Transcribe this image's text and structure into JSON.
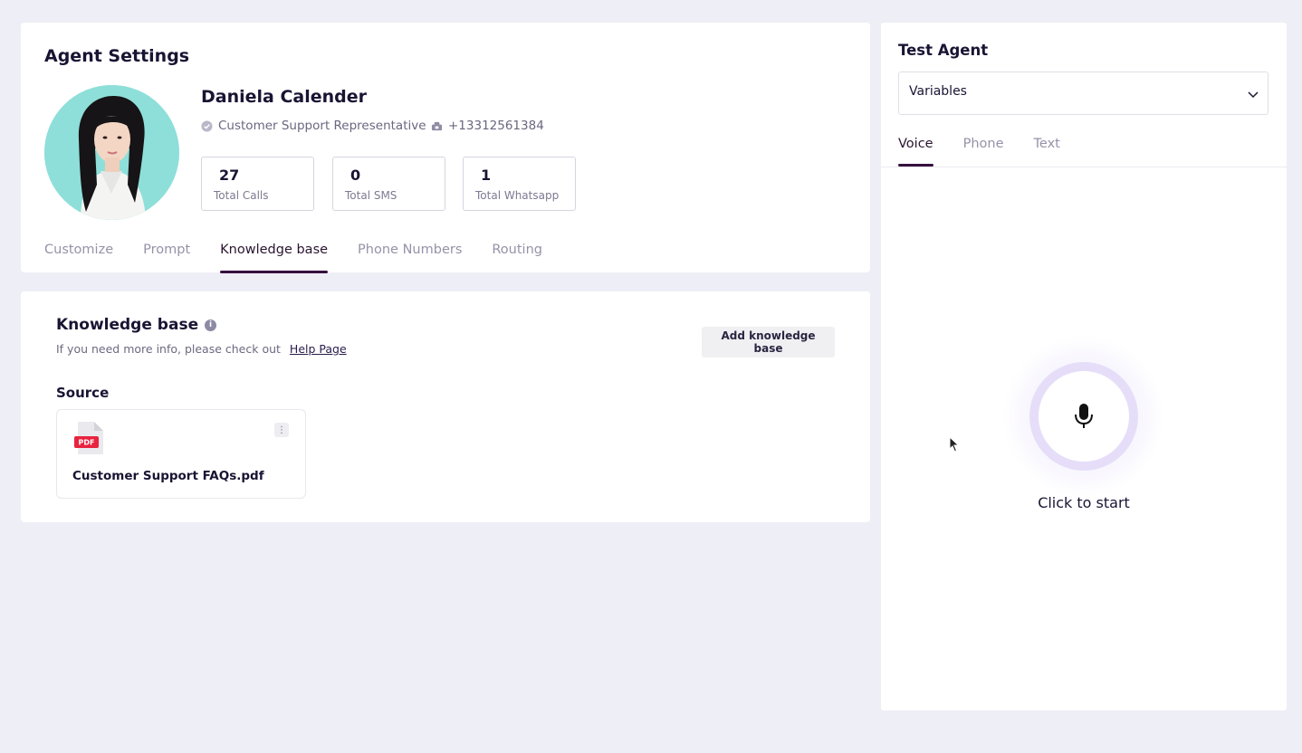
{
  "agent_settings": {
    "title": "Agent Settings",
    "agent_name": "Daniela Calender",
    "role": "Customer Support Representative",
    "phone": "+13312561384",
    "stats": [
      {
        "value": "27",
        "label": "Total Calls"
      },
      {
        "value": "0",
        "label": "Total SMS"
      },
      {
        "value": "1",
        "label": "Total Whatsapp"
      }
    ],
    "tabs": [
      "Customize",
      "Prompt",
      "Knowledge base",
      "Phone Numbers",
      "Routing"
    ],
    "active_tab": "Knowledge base"
  },
  "knowledge_base": {
    "title": "Knowledge base",
    "info_icon": "info-icon",
    "subtitle": "If you need more info, please check out",
    "help_link": "Help Page",
    "add_button": "Add knowledge base",
    "source_label": "Source",
    "files": [
      {
        "name": "Customer Support FAQs.pdf",
        "badge": "PDF",
        "icon": "pdf-file-icon"
      }
    ]
  },
  "test_agent": {
    "title": "Test Agent",
    "variables_label": "Variables",
    "tabs": [
      "Voice",
      "Phone",
      "Text"
    ],
    "active_tab": "Voice",
    "mic_label": "Click to start"
  },
  "colors": {
    "background": "#eeeef6",
    "accent": "#36103f",
    "pdf_red": "#e8233f",
    "mic_ring": "#e6def9",
    "avatar_bg": "#8edfd9"
  }
}
